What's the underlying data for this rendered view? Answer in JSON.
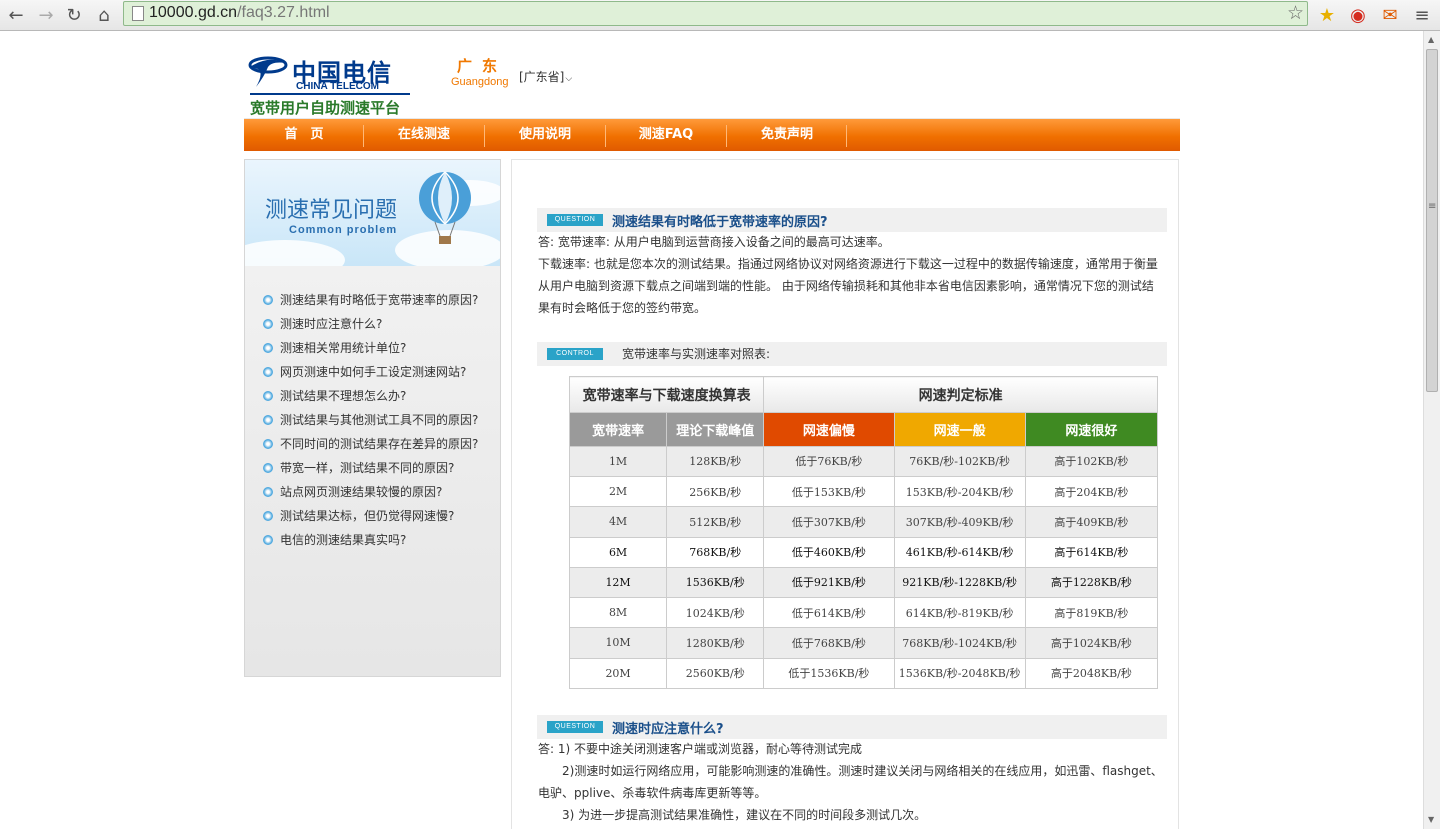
{
  "browser": {
    "url_host": "10000.gd.cn",
    "url_path": "/faq3.27.html"
  },
  "header": {
    "logo_cn": "中国电信",
    "logo_en": "CHINA TELECOM",
    "platform_title": "宽带用户自助测速平台",
    "region_cn": "广东",
    "region_pinyin": "Guangdong",
    "province_select": "[广东省]"
  },
  "nav": [
    "首　页",
    "在线测速",
    "使用说明",
    "测速FAQ",
    "免责声明"
  ],
  "sidebar": {
    "banner_title": "测速常见问题",
    "banner_subtitle": "Common problem",
    "items": [
      "测速结果有时略低于宽带速率的原因?",
      "测速时应注意什么?",
      "测速相关常用统计单位?",
      "网页测速中如何手工设定测速网站?",
      "测试结果不理想怎么办?",
      "测试结果与其他测试工具不同的原因?",
      "不同时间的测试结果存在差异的原因?",
      "带宽一样，测试结果不同的原因?",
      "站点网页测速结果较慢的原因?",
      "测试结果达标，但仍觉得网速慢?",
      "电信的测速结果真实吗?"
    ]
  },
  "content": {
    "q1": {
      "tag": "QUESTION",
      "title": "测速结果有时略低于宽带速率的原因?",
      "lines": [
        "答: 宽带速率: 从用户电脑到运营商接入设备之间的最高可达速率。",
        "下载速率: 也就是您本次的测试结果。指通过网络协议对网络资源进行下载这一过程中的数据传输速度，通常用于衡量",
        "从用户电脑到资源下载点之间端到端的性能。 由于网络传输损耗和其他非本省电信因素影响，通常情况下您的测试结",
        "果有时会略低于您的签约带宽。"
      ]
    },
    "control": {
      "tag": "CONTROL",
      "title": "宽带速率与实测速率对照表:"
    },
    "table": {
      "header_left": "宽带速率与下载速度换算表",
      "header_right": "网速判定标准",
      "cols": [
        "宽带速率",
        "理论下载峰值",
        "网速偏慢",
        "网速一般",
        "网速很好"
      ],
      "col_colors": [
        "#9a9a9a",
        "#9a9a9a",
        "#e04a00",
        "#f0a800",
        "#3f8a22"
      ],
      "rows": [
        [
          "1M",
          "128KB/秒",
          "低于76KB/秒",
          "76KB/秒-102KB/秒",
          "高于102KB/秒"
        ],
        [
          "2M",
          "256KB/秒",
          "低于153KB/秒",
          "153KB/秒-204KB/秒",
          "高于204KB/秒"
        ],
        [
          "4M",
          "512KB/秒",
          "低于307KB/秒",
          "307KB/秒-409KB/秒",
          "高于409KB/秒"
        ],
        [
          "6M",
          "768KB/秒",
          "低于460KB/秒",
          "461KB/秒-614KB/秒",
          "高于614KB/秒"
        ],
        [
          "12M",
          "1536KB/秒",
          "低于921KB/秒",
          "921KB/秒-1228KB/秒",
          "高于1228KB/秒"
        ],
        [
          "8M",
          "1024KB/秒",
          "低于614KB/秒",
          "614KB/秒-819KB/秒",
          "高于819KB/秒"
        ],
        [
          "10M",
          "1280KB/秒",
          "低于768KB/秒",
          "768KB/秒-1024KB/秒",
          "高于1024KB/秒"
        ],
        [
          "20M",
          "2560KB/秒",
          "低于1536KB/秒",
          "1536KB/秒-2048KB/秒",
          "高于2048KB/秒"
        ]
      ]
    },
    "q2": {
      "tag": "QUESTION",
      "title": "测速时应注意什么?",
      "lines": [
        "答: 1) 不要中途关闭测速客户端或浏览器，耐心等待测试完成",
        "　　2)测速时如运行网络应用，可能影响测速的准确性。测速时建议关闭与网络相关的在线应用，如迅雷、flashget、",
        "电驴、pplive、杀毒软件病毒库更新等等。",
        "　　3) 为进一步提高测试结果准确性，建议在不同的时间段多测试几次。"
      ]
    }
  }
}
